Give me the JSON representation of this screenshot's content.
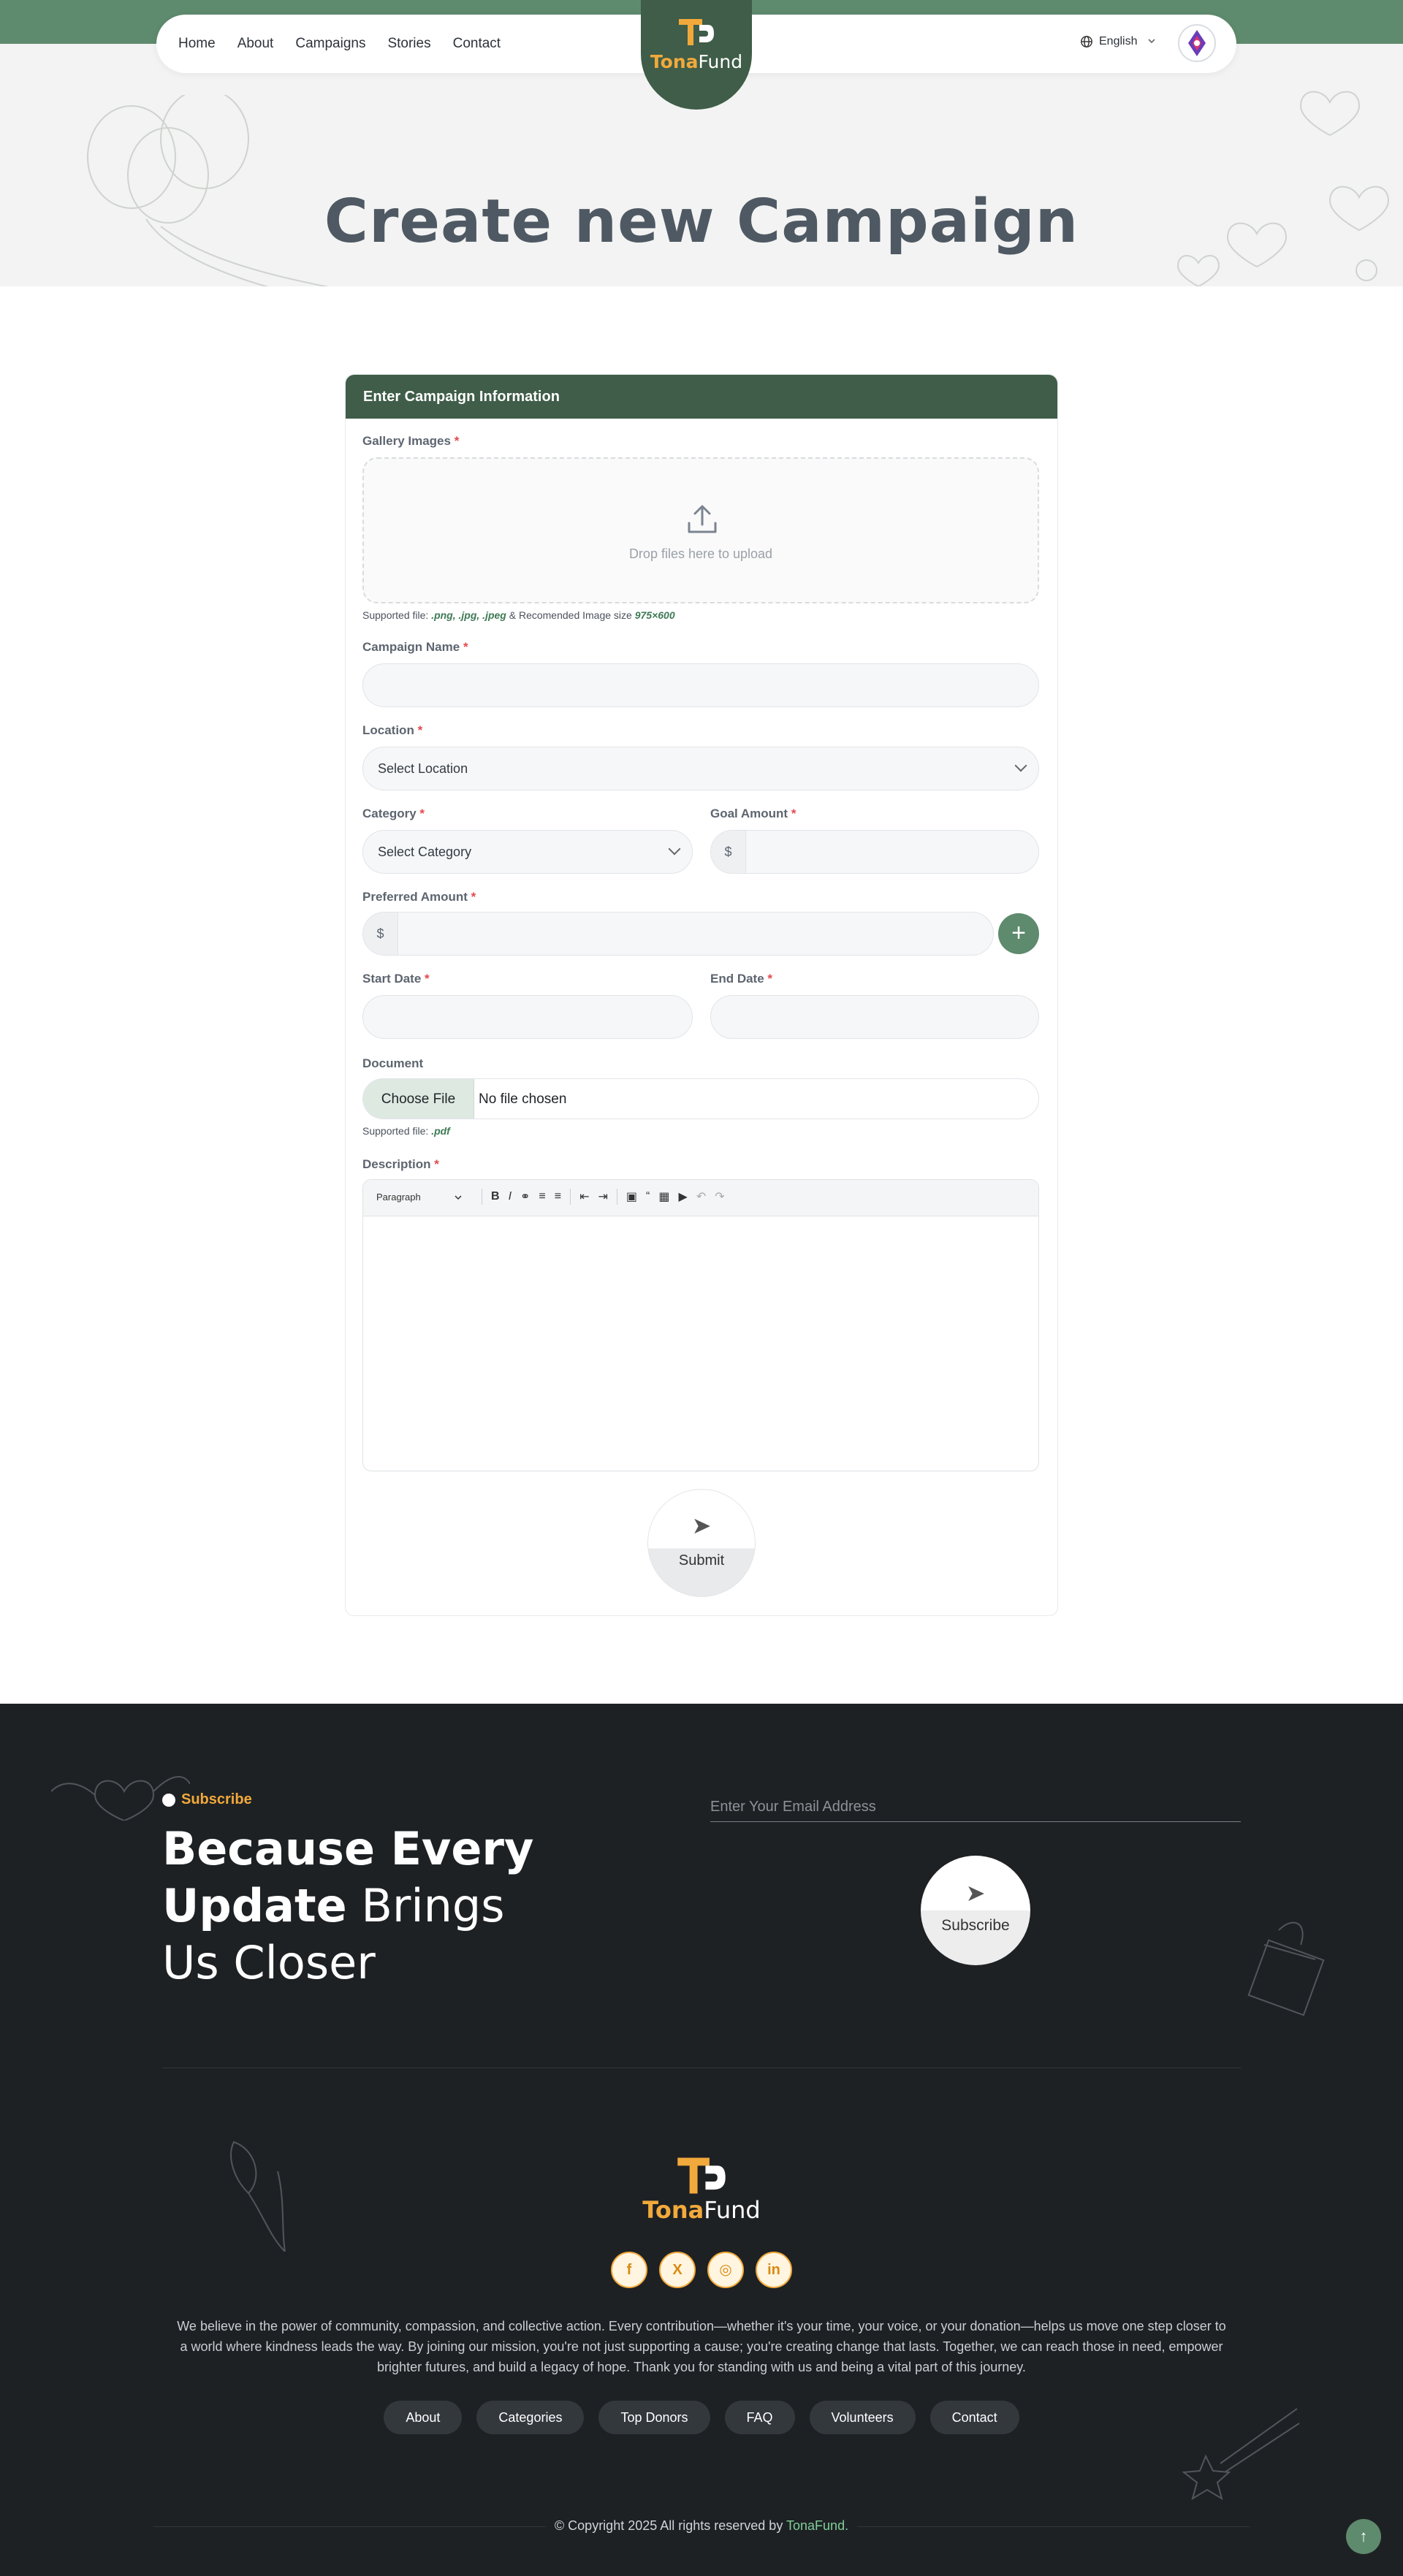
{
  "nav": {
    "links": [
      "Home",
      "About",
      "Campaigns",
      "Stories",
      "Contact"
    ],
    "logo_part1": "Tona",
    "logo_part2": "Fund",
    "language": "English"
  },
  "hero": {
    "title": "Create new Campaign"
  },
  "form": {
    "header": "Enter Campaign Information",
    "gallery_label": "Gallery Images",
    "dropzone_text": "Drop files here to upload",
    "gallery_hint_prefix": "Supported file:",
    "gallery_hint_types": ".png, .jpg, .jpeg",
    "gallery_hint_mid": "& Recomended Image size",
    "gallery_hint_size": "975×600",
    "campaign_name_label": "Campaign Name",
    "location_label": "Location",
    "location_value": "Select Location",
    "category_label": "Category",
    "category_value": "Select Category",
    "goal_amount_label": "Goal Amount",
    "currency": "$",
    "preferred_amount_label": "Preferred Amount",
    "start_date_label": "Start Date",
    "end_date_label": "End Date",
    "document_label": "Document",
    "choose_file": "Choose File",
    "no_file": "No file chosen",
    "document_hint_prefix": "Supported file:",
    "document_hint_types": ".pdf",
    "description_label": "Description",
    "editor_paragraph": "Paragraph",
    "submit_label": "Submit",
    "required_mark": "*"
  },
  "footer": {
    "subscribe_tag": "Subscribe",
    "headline_bold_1": "Because Every",
    "headline_bold_2": "Update",
    "headline_light": "Brings Us Closer",
    "email_placeholder": "Enter Your Email Address",
    "subscribe_button": "Subscribe",
    "logo_part1": "Tona",
    "logo_part2": "Fund",
    "social": [
      "f",
      "X",
      "◎",
      "in"
    ],
    "about": "We believe in the power of community, compassion, and collective action. Every contribution—whether it's your time, your voice, or your donation—helps us move one step closer to a world where kindness leads the way. By joining our mission, you're not just supporting a cause; you're creating change that lasts. Together, we can reach those in need, empower brighter futures, and build a legacy of hope. Thank you for standing with us and being a vital part of this journey.",
    "links": [
      "About",
      "Categories",
      "Top Donors",
      "FAQ",
      "Volunteers",
      "Contact"
    ],
    "copyright_prefix": "© Copyright 2025 All rights reserved by",
    "copyright_brand": "TonaFund."
  },
  "colors": {
    "primary_green": "#5e8a6d",
    "dark_green": "#3f5d48",
    "accent_orange": "#f2a93b",
    "footer_bg": "#1e2124"
  }
}
